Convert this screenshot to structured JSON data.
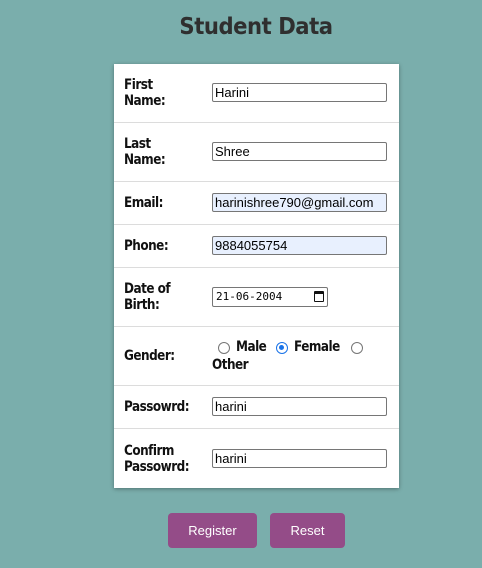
{
  "title": "Student Data",
  "form": {
    "first_name": {
      "label": "First Name:",
      "value": "Harini"
    },
    "last_name": {
      "label": "Last Name:",
      "value": "Shree"
    },
    "email": {
      "label": "Email:",
      "value": "harinishree790@gmail.com"
    },
    "phone": {
      "label": "Phone:",
      "value": "9884055754"
    },
    "dob": {
      "label": "Date of Birth:",
      "value": "21-06-2004"
    },
    "gender": {
      "label": "Gender:",
      "options": [
        "Male",
        "Female",
        "Other"
      ],
      "selected": "Female"
    },
    "password": {
      "label": "Passowrd:",
      "value": "harini"
    },
    "confirm_password": {
      "label": "Confirm Passowrd:",
      "value": "harini"
    }
  },
  "buttons": {
    "register": "Register",
    "reset": "Reset"
  },
  "colors": {
    "background": "#7aaeac",
    "button": "#944c88",
    "radio_accent": "#1a73e8"
  },
  "icons": {
    "date_picker": "calendar-icon"
  }
}
